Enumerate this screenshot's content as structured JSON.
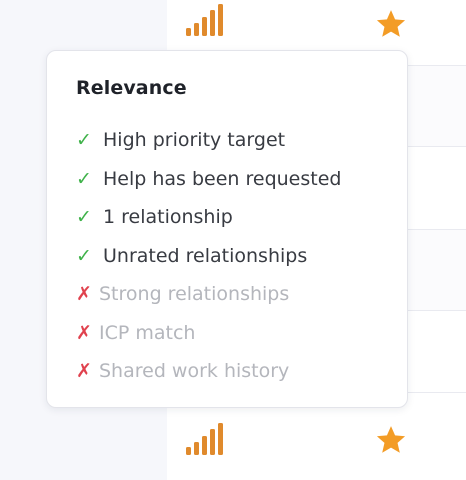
{
  "popover": {
    "title": "Relevance",
    "criteria": [
      {
        "label": "High priority target",
        "met": true,
        "mark": "✓"
      },
      {
        "label": "Help has been requested",
        "met": true,
        "mark": "✓"
      },
      {
        "label": "1 relationship",
        "met": true,
        "mark": "✓"
      },
      {
        "label": "Unrated relationships",
        "met": true,
        "mark": "✓"
      },
      {
        "label": "Strong relationships",
        "met": false,
        "mark": "✗"
      },
      {
        "label": "ICP match",
        "met": false,
        "mark": "✗"
      },
      {
        "label": "Shared work history",
        "met": false,
        "mark": "✗"
      }
    ]
  },
  "rows": [
    {
      "relevance_icon": "signal-bars-icon",
      "starred": true
    },
    {
      "relevance_icon": "signal-bars-icon",
      "starred": true
    }
  ],
  "colors": {
    "accent_orange": "#e08a2c",
    "star": "#f39c26",
    "met": "#3fb24a",
    "unmet": "#e0424e",
    "unmet_text": "#b4b6bc"
  }
}
